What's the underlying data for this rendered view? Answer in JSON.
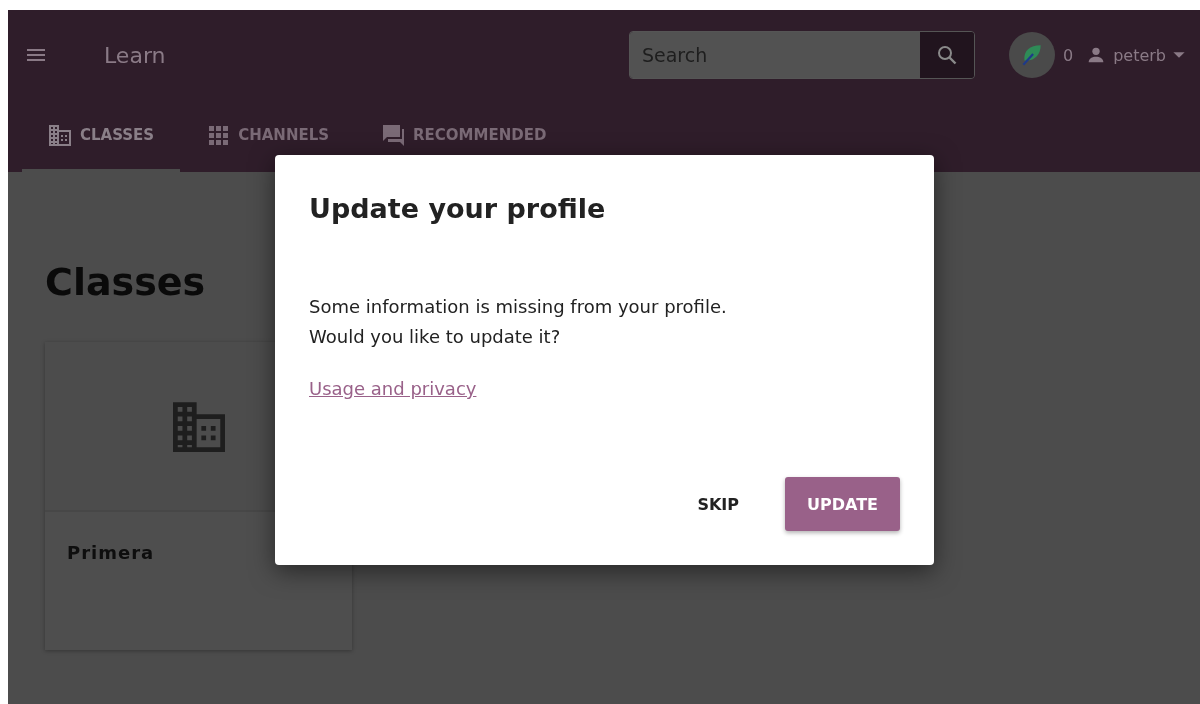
{
  "app_bar": {
    "title": "Learn",
    "search": {
      "placeholder": "Search"
    },
    "points": "0",
    "user": "peterb"
  },
  "tabs": [
    {
      "label": "CLASSES",
      "kind": "classes",
      "selected": true
    },
    {
      "label": "CHANNELS",
      "kind": "channels",
      "selected": false
    },
    {
      "label": "RECOMMENDED",
      "kind": "recommended",
      "selected": false
    }
  ],
  "page": {
    "heading": "Classes",
    "cards": [
      {
        "title": "Primera"
      }
    ]
  },
  "dialog": {
    "title": "Update your profile",
    "body": [
      "Some information is missing from your profile.",
      "Would you like to update it?"
    ],
    "link": "Usage and privacy",
    "buttons": [
      {
        "label": "SKIP",
        "kind": "flat"
      },
      {
        "label": "UPDATE",
        "kind": "raised"
      }
    ]
  }
}
